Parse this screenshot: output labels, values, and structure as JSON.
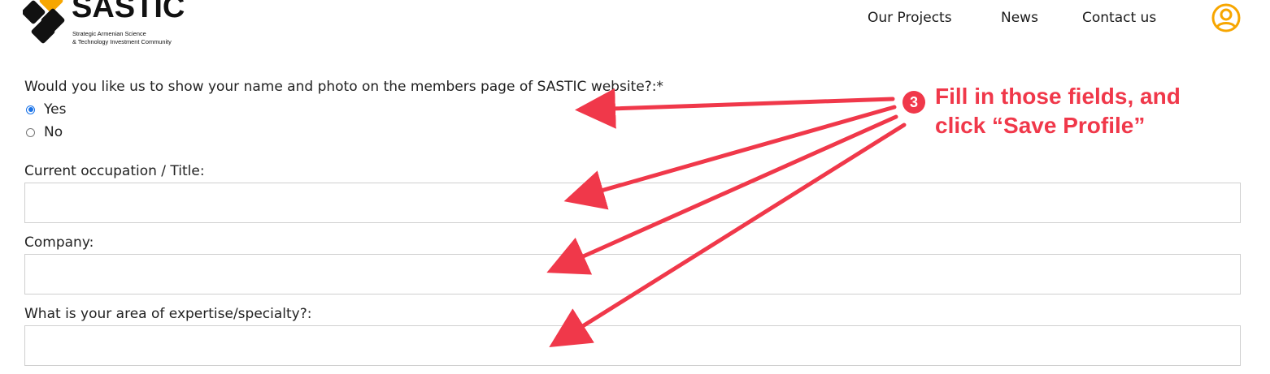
{
  "header": {
    "logo": {
      "wordmark": "SASTIC",
      "tagline_line1": "Strategic Armenian Science",
      "tagline_line2": "& Technology Investment Community"
    },
    "nav": {
      "items": [
        "Our Projects",
        "News",
        "Contact us"
      ]
    },
    "user_icon": "user-circle-icon",
    "accent_color": "#f7a600"
  },
  "form": {
    "show_profile": {
      "question": "Would you like us to show your name and photo on the members page of SASTIC website?:*",
      "options": [
        "Yes",
        "No"
      ],
      "selected": "Yes"
    },
    "occupation": {
      "label": "Current occupation / Title:",
      "value": ""
    },
    "company": {
      "label": "Company:",
      "value": ""
    },
    "expertise": {
      "label": "What is your area of expertise/specialty?:",
      "value": ""
    }
  },
  "annotation": {
    "step": "3",
    "line1": "Fill in those fields, and",
    "line2": "click “Save Profile”",
    "color": "#f0384a"
  }
}
